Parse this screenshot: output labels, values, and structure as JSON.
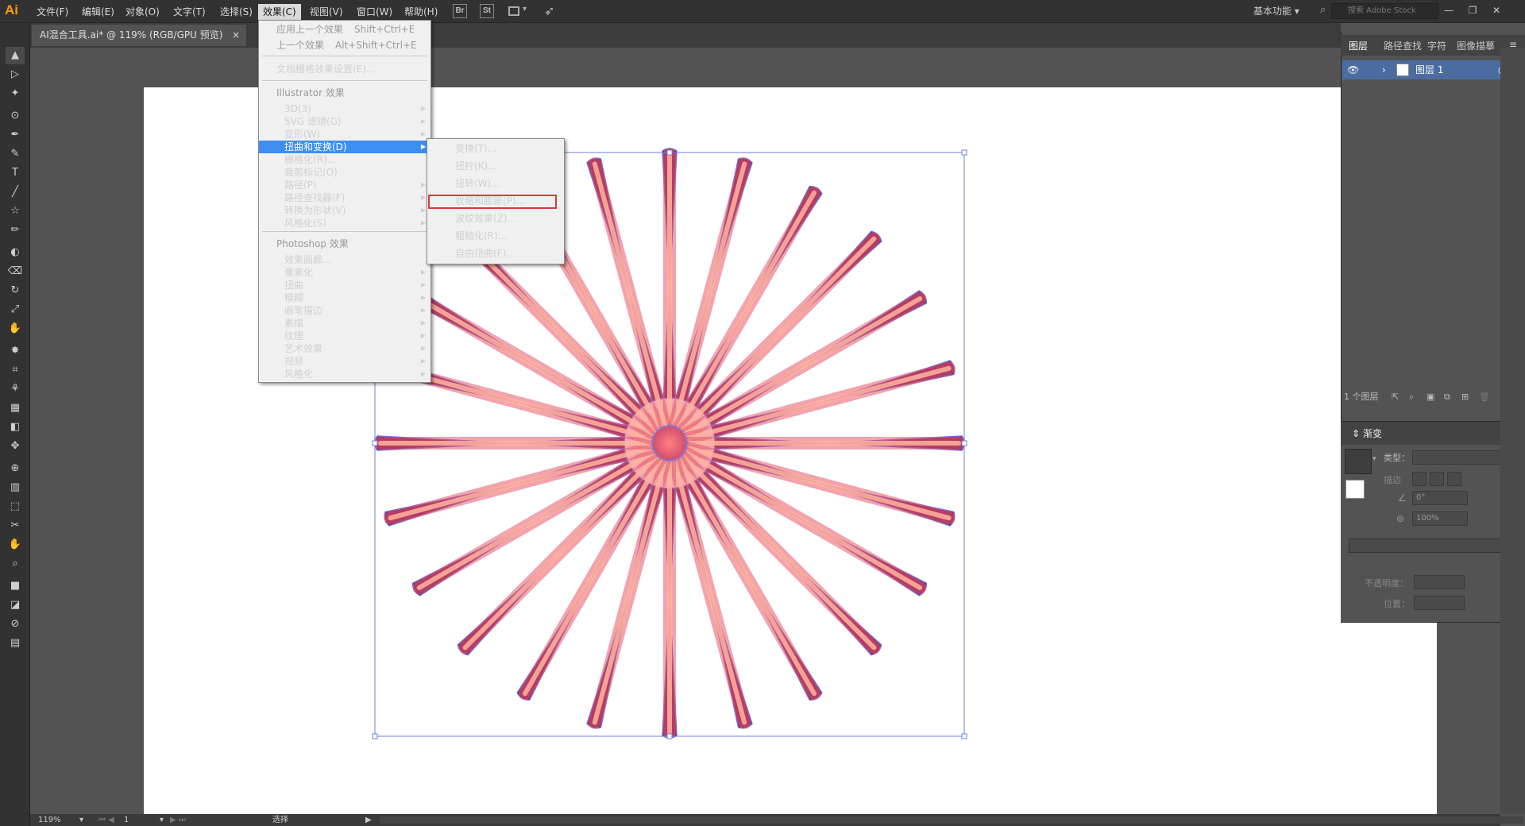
{
  "app": {
    "logo": "Ai",
    "accent": "#ff9a00"
  },
  "menubar": {
    "items": [
      "文件(F)",
      "编辑(E)",
      "对象(O)",
      "文字(T)",
      "选择(S)",
      "效果(C)",
      "视图(V)",
      "窗口(W)",
      "帮助(H)"
    ],
    "active": "效果(C)",
    "toolbar_icons": [
      "Br",
      "St"
    ],
    "workspace": "基本功能",
    "search_placeholder": "搜索 Adobe Stock",
    "window_buttons": [
      "minimize",
      "restore",
      "close"
    ]
  },
  "document_tab": {
    "title": "AI混合工具.ai* @ 119% (RGB/GPU 预览)",
    "close": "×"
  },
  "effect_menu": {
    "top_items": [
      {
        "label": "应用上一个效果",
        "shortcut": "Shift+Ctrl+E",
        "disabled": true
      },
      {
        "label": "上一个效果",
        "shortcut": "Alt+Shift+Ctrl+E",
        "disabled": true
      },
      {
        "label": "文档栅格效果设置(E)...",
        "shortcut": "",
        "disabled": false
      }
    ],
    "illustrator_header": "Illustrator 效果",
    "illustrator_items": [
      "3D(3)",
      "SVG 滤镜(G)",
      "变形(W)",
      "扭曲和变换(D)",
      "栅格化(R)...",
      "裁剪标记(O)",
      "路径(P)",
      "路径查找器(F)",
      "转换为形状(V)",
      "风格化(S)"
    ],
    "illustrator_arrows": [
      true,
      true,
      true,
      true,
      false,
      false,
      true,
      true,
      true,
      true
    ],
    "highlighted": "扭曲和变换(D)",
    "photoshop_header": "Photoshop 效果",
    "photoshop_items": [
      "效果画廊...",
      "像素化",
      "扭曲",
      "模糊",
      "画笔描边",
      "素描",
      "纹理",
      "艺术效果",
      "视频",
      "风格化"
    ],
    "photoshop_arrows": [
      false,
      true,
      true,
      true,
      true,
      true,
      true,
      true,
      true,
      true
    ]
  },
  "distort_submenu": {
    "items": [
      "变换(T)...",
      "扭拧(K)...",
      "扭转(W)...",
      "收缩和膨胀(P)...",
      "波纹效果(Z)...",
      "粗糙化(R)...",
      "自由扭曲(F)..."
    ],
    "boxed": "收缩和膨胀(P)...",
    "box_color": "#d83a3a"
  },
  "layers_panel": {
    "tabs": [
      "图层",
      "路径查找",
      "字符",
      "图像描摹"
    ],
    "active_tab": "图层",
    "layer_name": "图层 1",
    "footer": "1 个图层"
  },
  "gradient_panel": {
    "title": "渐变",
    "type_label": "类型：",
    "stroke_label": "描边",
    "angle_value": "0°",
    "aspect_value": "100%",
    "opacity_label": "不透明度：",
    "position_label": "位置："
  },
  "statusbar": {
    "zoom": "119%",
    "page": "1",
    "tool": "选择"
  },
  "artwork": {
    "spike_count": 24,
    "colors": [
      "#ffb4a0",
      "#e8586a",
      "#7a1a5a",
      "#4a0e4e"
    ],
    "outline": "#6a6ad8"
  }
}
